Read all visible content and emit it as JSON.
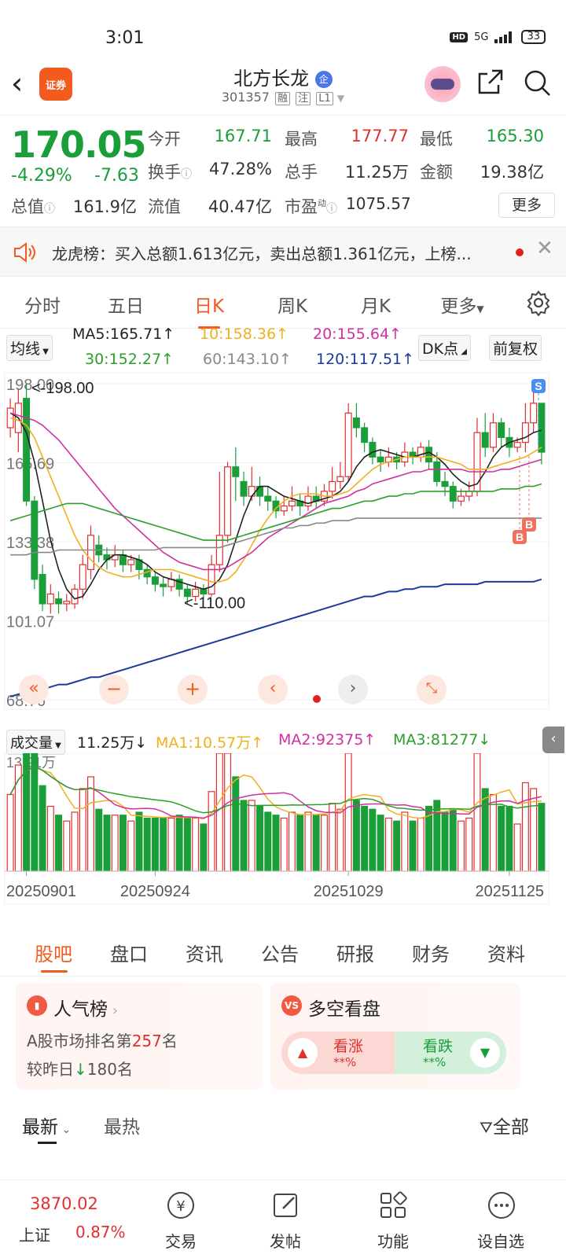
{
  "status": {
    "time": "3:01",
    "hd": "HD",
    "net": "5G",
    "battery": "33"
  },
  "header": {
    "back": "‹",
    "app_logo": "证券",
    "name": "北方长龙",
    "qi_badge": "企",
    "code": "301357",
    "tags": [
      "融",
      "注",
      "L1"
    ]
  },
  "quote": {
    "price": "170.05",
    "pct": "-4.29%",
    "chg": "-7.63",
    "open_label": "今开",
    "open": "167.71",
    "high_label": "最高",
    "high": "177.77",
    "low_label": "最低",
    "low": "165.30",
    "turnover_label": "换手",
    "turnover": "47.28%",
    "vol_label": "总手",
    "vol": "11.25万",
    "amount_label": "金额",
    "amount": "19.38亿",
    "mktcap_label": "总值",
    "mktcap": "161.9亿",
    "float_label": "流值",
    "float": "40.47亿",
    "pe_label": "市盈",
    "pe_sup": "动",
    "pe": "1075.57",
    "more": "更多"
  },
  "notice": {
    "text": "龙虎榜：买入总额1.613亿元，卖出总额1.361亿元，上榜..."
  },
  "tabs": [
    "分时",
    "五日",
    "日K",
    "周K",
    "月K",
    "更多"
  ],
  "active_tab": 2,
  "ma_bar": {
    "selector": "均线",
    "ma5": "MA5:165.71↑",
    "ma10": "10:158.36↑",
    "ma20": "20:155.64↑",
    "ma30": "30:152.27↑",
    "ma60": "60:143.10↑",
    "ma120": "120:117.51↑",
    "dk": "DK点",
    "adjust": "前复权"
  },
  "chart_data": {
    "type": "candlestick",
    "y_ticks": [
      "198.00",
      "165.69",
      "133.38",
      "101.07",
      "68.76"
    ],
    "ylim": [
      68.76,
      198.0
    ],
    "annotations": [
      "<-198.00",
      "<-110.00"
    ],
    "markers": [
      "S",
      "B",
      "B"
    ],
    "x_ticks": [
      "20250901",
      "20250924",
      "20251029",
      "20251125"
    ],
    "candles": [
      [
        180,
        188,
        176,
        192
      ],
      [
        178,
        190,
        170,
        196
      ],
      [
        192,
        150,
        148,
        198
      ],
      [
        150,
        118,
        114,
        152
      ],
      [
        120,
        108,
        105,
        124
      ],
      [
        108,
        112,
        104,
        116
      ],
      [
        110,
        108,
        104,
        113
      ],
      [
        108,
        109,
        105,
        112
      ],
      [
        108,
        114,
        106,
        116
      ],
      [
        114,
        124,
        110,
        128
      ],
      [
        122,
        136,
        118,
        140
      ],
      [
        132,
        128,
        125,
        136
      ],
      [
        128,
        126,
        122,
        131
      ],
      [
        126,
        128,
        123,
        132
      ],
      [
        128,
        124,
        121,
        130
      ],
      [
        124,
        126,
        121,
        128
      ],
      [
        126,
        122,
        118,
        128
      ],
      [
        122,
        119,
        116,
        124
      ],
      [
        119,
        116,
        113,
        121
      ],
      [
        116,
        115,
        111,
        119
      ],
      [
        115,
        118,
        113,
        121
      ],
      [
        118,
        114,
        111,
        120
      ],
      [
        114,
        111,
        108,
        116
      ],
      [
        111,
        114,
        109,
        117
      ],
      [
        114,
        112,
        110,
        116
      ],
      [
        112,
        124,
        111,
        128
      ],
      [
        124,
        136,
        121,
        162
      ],
      [
        136,
        164,
        133,
        166
      ],
      [
        164,
        160,
        150,
        172
      ],
      [
        158,
        152,
        148,
        162
      ],
      [
        152,
        156,
        150,
        164
      ],
      [
        156,
        152,
        148,
        160
      ],
      [
        152,
        150,
        146,
        156
      ],
      [
        150,
        146,
        143,
        152
      ],
      [
        146,
        148,
        144,
        152
      ],
      [
        148,
        150,
        146,
        156
      ],
      [
        150,
        148,
        144,
        153
      ],
      [
        148,
        152,
        146,
        156
      ],
      [
        152,
        150,
        147,
        156
      ],
      [
        150,
        154,
        148,
        157
      ],
      [
        154,
        158,
        151,
        164
      ],
      [
        158,
        160,
        155,
        166
      ],
      [
        160,
        186,
        158,
        190
      ],
      [
        184,
        180,
        176,
        190
      ],
      [
        180,
        174,
        170,
        182
      ],
      [
        174,
        168,
        165,
        176
      ],
      [
        168,
        166,
        162,
        171
      ],
      [
        166,
        168,
        164,
        172
      ],
      [
        168,
        166,
        163,
        170
      ],
      [
        166,
        170,
        164,
        174
      ],
      [
        170,
        168,
        165,
        172
      ],
      [
        168,
        172,
        166,
        174
      ],
      [
        172,
        166,
        163,
        175
      ],
      [
        166,
        158,
        156,
        170
      ],
      [
        158,
        156,
        152,
        162
      ],
      [
        156,
        150,
        147,
        158
      ],
      [
        150,
        152,
        148,
        155
      ],
      [
        152,
        154,
        150,
        158
      ],
      [
        154,
        178,
        152,
        184
      ],
      [
        178,
        172,
        168,
        186
      ],
      [
        172,
        182,
        170,
        186
      ],
      [
        182,
        176,
        172,
        184
      ],
      [
        176,
        172,
        168,
        180
      ],
      [
        172,
        174,
        170,
        176
      ],
      [
        174,
        182,
        170,
        190
      ],
      [
        182,
        190,
        178,
        196
      ],
      [
        190,
        170,
        165,
        178
      ]
    ],
    "ma": {
      "MA5": [
        186,
        184,
        178,
        166,
        150,
        134,
        122,
        114,
        110,
        111,
        116,
        122,
        126,
        128,
        128,
        127,
        126,
        124,
        121,
        119,
        118,
        117,
        116,
        115,
        114,
        115,
        118,
        124,
        134,
        144,
        152,
        156,
        156,
        154,
        152,
        151,
        150,
        149,
        150,
        151,
        152,
        154,
        158,
        164,
        168,
        170,
        171,
        170,
        169,
        168,
        168,
        169,
        170,
        168,
        165,
        161,
        158,
        156,
        157,
        162,
        168,
        172,
        174,
        175,
        176,
        178,
        179
      ],
      "MA10": [
        184,
        183,
        181,
        176,
        168,
        160,
        152,
        144,
        136,
        130,
        126,
        123,
        121,
        120,
        119,
        119,
        120,
        121,
        122,
        122,
        122,
        121,
        120,
        119,
        118,
        117,
        117,
        118,
        121,
        126,
        132,
        138,
        143,
        147,
        150,
        152,
        153,
        153,
        153,
        152,
        152,
        153,
        154,
        157,
        160,
        163,
        165,
        166,
        167,
        168,
        168,
        168,
        168,
        168,
        167,
        166,
        165,
        163,
        163,
        163,
        164,
        165,
        166,
        167,
        168,
        170,
        172
      ],
      "MA20": [
        186,
        185,
        184,
        183,
        181,
        178,
        175,
        171,
        167,
        163,
        159,
        155,
        151,
        147,
        144,
        141,
        138,
        135,
        132,
        129,
        127,
        125,
        124,
        123,
        122,
        122,
        122,
        123,
        125,
        127,
        129,
        132,
        135,
        137,
        139,
        141,
        143,
        145,
        147,
        149,
        150,
        151,
        152,
        154,
        155,
        157,
        158,
        159,
        160,
        161,
        162,
        162,
        163,
        163,
        163,
        163,
        163,
        162,
        162,
        162,
        162,
        163,
        163,
        164,
        165,
        166,
        167
      ],
      "MA30": [
        142,
        143,
        144,
        145,
        146,
        147,
        148,
        149,
        149,
        149,
        148,
        147,
        146,
        145,
        144,
        143,
        142,
        141,
        140,
        139,
        138,
        137,
        136,
        135,
        134,
        134,
        134,
        134,
        135,
        136,
        137,
        138,
        139,
        140,
        141,
        142,
        143,
        144,
        145,
        146,
        147,
        147,
        148,
        149,
        150,
        150,
        151,
        152,
        152,
        153,
        153,
        154,
        154,
        154,
        154,
        154,
        154,
        154,
        154,
        154,
        154,
        155,
        155,
        155,
        156,
        156,
        157
      ],
      "MA60": [
        128,
        128,
        128,
        129,
        129,
        129,
        130,
        130,
        130,
        130,
        130,
        130,
        130,
        130,
        130,
        130,
        130,
        130,
        130,
        131,
        131,
        131,
        131,
        131,
        131,
        131,
        131,
        132,
        133,
        134,
        135,
        136,
        137,
        138,
        139,
        139,
        140,
        140,
        141,
        141,
        142,
        142,
        142,
        143,
        143,
        143,
        143,
        143,
        143,
        143,
        143,
        143,
        143,
        143,
        143,
        143,
        143,
        143,
        143,
        143,
        143,
        143,
        143,
        143,
        143,
        143,
        143
      ],
      "MA120": [
        70,
        71,
        72,
        72,
        73,
        74,
        75,
        75,
        76,
        77,
        78,
        78,
        79,
        80,
        81,
        82,
        83,
        84,
        85,
        86,
        87,
        88,
        89,
        90,
        91,
        92,
        93,
        94,
        95,
        96,
        97,
        98,
        99,
        100,
        101,
        102,
        103,
        104,
        105,
        106,
        107,
        108,
        109,
        110,
        111,
        111,
        112,
        113,
        113,
        114,
        114,
        115,
        115,
        115,
        116,
        116,
        116,
        116,
        116,
        117,
        117,
        117,
        117,
        117,
        117,
        117,
        118
      ]
    }
  },
  "volume": {
    "selector": "成交量",
    "latest": "11.25万↓",
    "ma1": "MA1:10.57万↑",
    "ma2": "MA2:92375↑",
    "ma3": "MA3:81277↓",
    "max_label": "13.91万"
  },
  "bottom_tabs": [
    "股吧",
    "盘口",
    "资讯",
    "公告",
    "研报",
    "财务",
    "资料"
  ],
  "popular": {
    "title": "人气榜",
    "rank_prefix": "A股市场排名第",
    "rank": "257",
    "rank_suffix": "名",
    "change_prefix": "较昨日",
    "change": "180",
    "change_suffix": "名"
  },
  "sentiment": {
    "title": "多空看盘",
    "up_label": "看涨",
    "up_value": "**%",
    "down_label": "看跌",
    "down_value": "**%"
  },
  "feed": {
    "latest": "最新",
    "hot": "最热",
    "filter": "全部"
  },
  "index": {
    "value": "3870.02",
    "name": "上证",
    "pct": "0.87%"
  },
  "nav": [
    "交易",
    "发帖",
    "功能",
    "设自选"
  ],
  "colors": {
    "up": "#e03030",
    "down": "#1a9e3a",
    "accent": "#f25a1e",
    "ma5": "#222222",
    "ma10": "#f0b020",
    "ma20": "#d030a0",
    "ma30": "#2aa02a",
    "ma60": "#888888",
    "ma120": "#1a3a9e"
  }
}
